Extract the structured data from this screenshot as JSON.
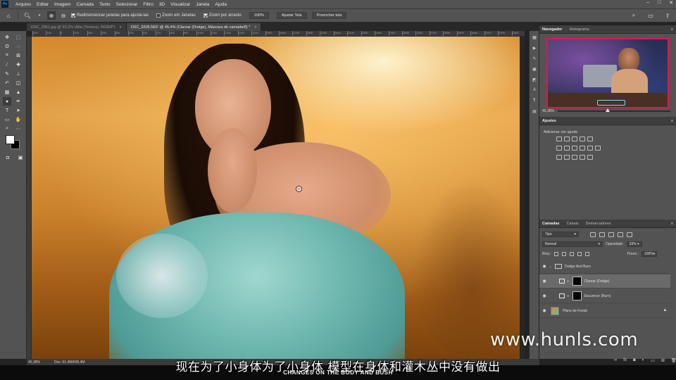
{
  "menubar": {
    "items": [
      "Arquivo",
      "Editar",
      "Imagem",
      "Camada",
      "Texto",
      "Selecionar",
      "Filtro",
      "3D",
      "Visualizar",
      "Janela",
      "Ajuda"
    ],
    "win_minimize": "–",
    "win_maximize": "□",
    "win_close": "✕"
  },
  "options": {
    "resize_windows_label": "Redimensionar janelas para ajustá-las",
    "zoom_all_windows_label": "Zoom em Janelas",
    "scrubby_zoom_label": "Zoom por arrasto",
    "zoom_100_label": "100%",
    "fit_screen_label": "Ajustar Tela",
    "fill_screen_label": "Preencher tela"
  },
  "tabs": [
    {
      "label": "DSC_2861.jpg @ 93,2% (Alta (Textura), RGB/8*)",
      "active": false
    },
    {
      "label": "DSC_9205.NEF @ 45,4% (Clarear (Dodge), Máscara de camada/8) *",
      "active": true
    }
  ],
  "ruler_top_ticks": [
    "200",
    "100",
    "0",
    "100",
    "200",
    "300",
    "400",
    "500",
    "600",
    "700",
    "800",
    "900",
    "1000",
    "1100",
    "1200",
    "1300",
    "1400",
    "1500",
    "1600",
    "1700",
    "1800",
    "1900",
    "2000",
    "2100",
    "2200",
    "2300",
    "2400",
    "2500",
    "2600",
    "2700",
    "2800",
    "2900",
    "3000",
    "3100",
    "3200",
    "3300"
  ],
  "navigator": {
    "tabs": [
      "Navegador",
      "Histograma"
    ],
    "zoom": "45,38%"
  },
  "adjustments": {
    "title": "Ajustes",
    "add_label": "Adicionar um ajuste"
  },
  "layers": {
    "tabs": [
      "Camadas",
      "Canais",
      "Demarcadores"
    ],
    "filter_type": "Tipo",
    "blend_mode": "Normal",
    "opacity_label": "Opacidade:",
    "opacity_value": "33%",
    "lock_label": "Bloq.:",
    "fill_label": "Preen.:",
    "fill_value": "100%",
    "items": [
      {
        "name": "Dodge And Burn",
        "type": "group",
        "selected": false
      },
      {
        "name": "Clarear (Dodge)",
        "type": "layer",
        "selected": true
      },
      {
        "name": "Escurecer (Burn)",
        "type": "layer",
        "selected": false
      },
      {
        "name": "Plano de Fundo",
        "type": "background",
        "selected": false
      }
    ]
  },
  "status": {
    "zoom": "45,38%",
    "doc": "Doc: 61,4M/695,4M"
  },
  "overlay": {
    "subtitle": "现在为了小身体为了小身体 模型在身体和灌木丛中没有做出",
    "subtitle_english": "CHANGES ON THE BODY AND BUSH",
    "watermark": "www.hunls.com"
  },
  "colors": {
    "ui_dark": "#535353",
    "ui_panel_header": "#3e3e3e",
    "selected_layer": "#6a6a6a",
    "nav_frame": "#e0174a"
  }
}
